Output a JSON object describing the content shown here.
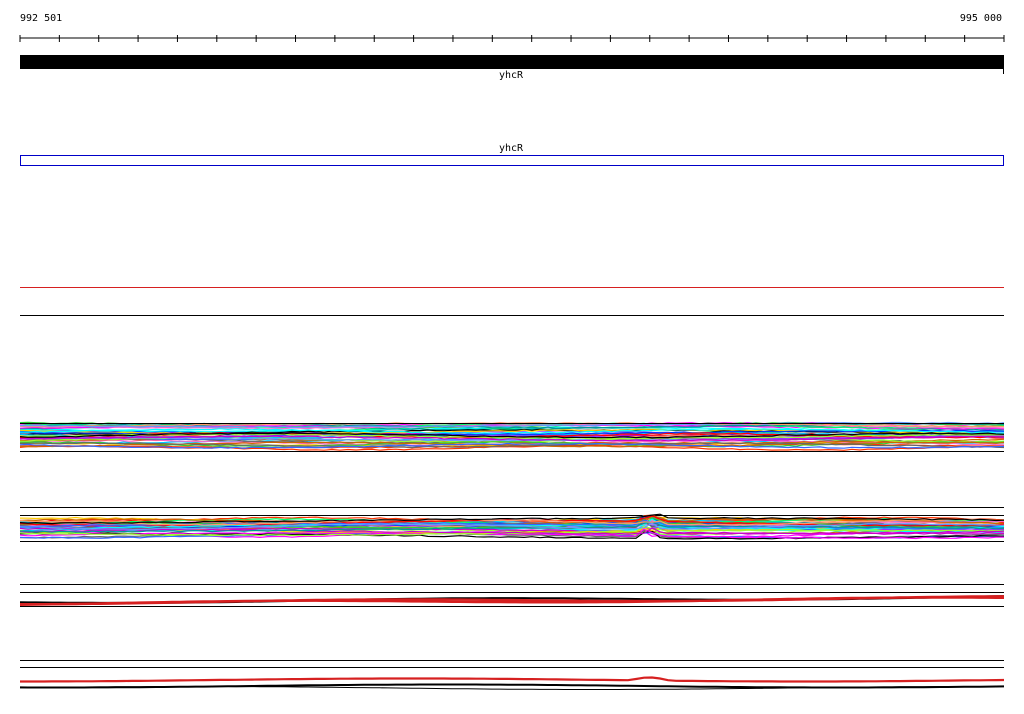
{
  "region": {
    "start": 992501,
    "end": 995000,
    "start_label": "992 501",
    "end_label": "995 000"
  },
  "genes": [
    {
      "name": "yhcR",
      "track": "annotation",
      "style": "filled-black"
    },
    {
      "name": "yhcR",
      "track": "feature",
      "style": "outline-blue"
    }
  ],
  "colors": {
    "annotation_fill": "#000000",
    "feature_outline": "#0000c8",
    "red_line": "#d62020"
  },
  "profile_tracks": [
    {
      "id": "multi-condition-profiles-1",
      "series_count": 40
    },
    {
      "id": "multi-condition-profiles-2",
      "series_count": 40
    },
    {
      "id": "strand-profile-1",
      "series_count": 3
    },
    {
      "id": "strand-profile-2",
      "series_count": 3
    }
  ]
}
